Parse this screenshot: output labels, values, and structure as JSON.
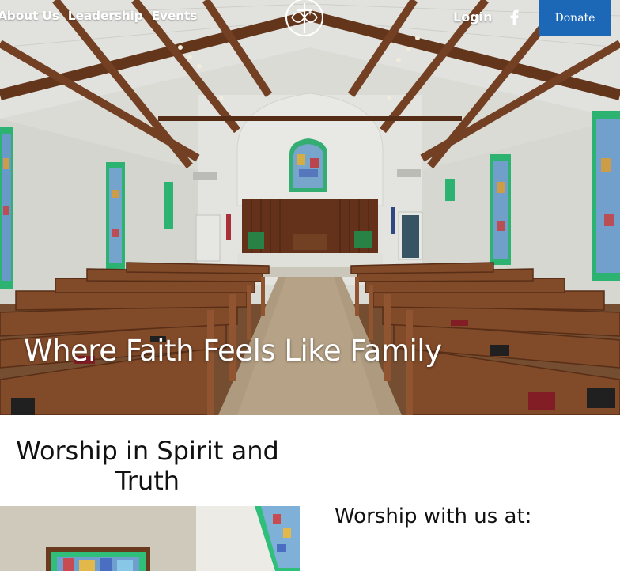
{
  "nav": {
    "links": [
      "About Us",
      "Leadership",
      "Events"
    ],
    "login_label": "Login",
    "donate_label": "Donate",
    "logo_icon": "cross-circle-logo-icon",
    "social_icon": "facebook-icon"
  },
  "hero": {
    "headline": "Where Faith Feels Like Family"
  },
  "worship": {
    "section_title": "Worship in Spirit and Truth",
    "location_heading": "Worship with us at:"
  },
  "colors": {
    "accent": "#1d68b6",
    "wood": "#6e3e24",
    "wall": "#eeeeea"
  }
}
